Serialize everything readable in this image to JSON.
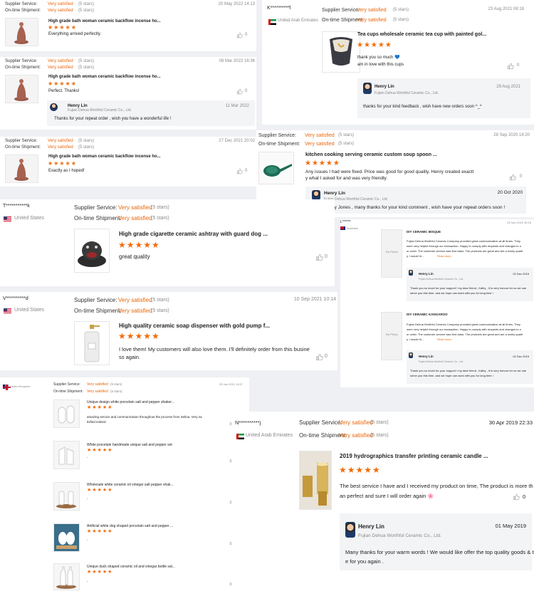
{
  "common": {
    "supplier_service": "Supplier Service:",
    "ontime_shipment": "On-time Shipment:",
    "very_satisfied": "Very satisfied",
    "five_stars": "(5 stars)",
    "stars": "★★★★★",
    "like_count": "0",
    "replier_name": "Henry Lin",
    "replier_company": "Fujian Dehua Worthful Ceramic Co., Ltd.",
    "no_photo": "No Photo"
  },
  "r1": {
    "date": "20 May 2022 14:13",
    "product": "High grade bath woman ceramic backflow incense ho...",
    "comment": "Everything arrived perfectly."
  },
  "r2": {
    "date": "08 Mar 2022 16:36",
    "product": "High grade bath woman ceramic backflow incense ho...",
    "comment": "Perfect. Thanks!",
    "reply_date": "11 Mar 2022",
    "reply_text": "Thanks for your repeat order , wish you have a wonderful life !"
  },
  "r3": {
    "date": "27 Dec 2021 20:02",
    "product": "High grade bath woman ceramic backflow incense ho...",
    "comment": "Exactly as I hoped!"
  },
  "r4": {
    "user": "K**********l",
    "country": "United Arab Emirates",
    "date": "23 Aug 2021 08:18",
    "product": "Tea cups wholesale ceramic tea cup with painted gol...",
    "comment_1": "thank you so much 💙",
    "comment_2": "am in love with this cups",
    "reply_date": "29 Aug 2021",
    "reply_text": "thanks for your kind feedback , wish have new orders soon ^_^"
  },
  "r5": {
    "date": "28 Sep 2020 14:20",
    "product": "kitchen cooking serving ceramic custom soup spoon ...",
    "comment_1": "Any issues I had were fixed. Price was good for good quality. Henry created exactl",
    "comment_2": "y what I asked for and was very friendly.",
    "reply_date": "20 Oct 2020",
    "reply_text": "Dear Tiffany Jones , many thanks for your kind comment , wish have your repeat orders soon !"
  },
  "r6": {
    "user": "T***********k",
    "country": "United States",
    "product": "High grade cigarette ceramic ashtray with guard dog ...",
    "comment": "great quality"
  },
  "r7": {
    "user": "L******",
    "country": "Australia",
    "date": "04 Nov 2015 15:18",
    "items": [
      {
        "title": "DIY CERAMIC BISQUE",
        "text": [
          "Fujian Dehua Worthful Ceramic Company provided great communication at all times. They",
          "were very helpful through our transaction. Happy to comply with requests and changes to o",
          "ur order. The customer service was first class. The products are great and are a lovely qualit",
          "y. I would hi..."
        ],
        "read_more": "Read more",
        "reply_date": "02 Dec 2015",
        "reply_text": [
          "Thank you so much for your support ! my dear friend , Kathy , It is very honour for us we can",
          "serve you this time, and we hope can work with you for long time !"
        ]
      },
      {
        "title": "DIY CERAMIC KANGAROO",
        "text": [
          "Fujian Dehua Worthful Ceramic Company provided great communication at all times. They",
          "were very helpful through our transaction. Happy to comply with requests and changes to o",
          "ur order. The customer service was first class. The products are great and are a lovely qualit",
          "y. I would hi..."
        ],
        "read_more": "Read more",
        "reply_date": "02 Dec 2015",
        "reply_text": [
          "Thank you so much for your support ! my dear friend , Kathy , It is very honour for us we can",
          "serve you this time, and we hope can work with you for long time !"
        ]
      }
    ]
  },
  "r8": {
    "user": "V**********d",
    "country": "United States",
    "date": "10 Sep 2021 10:14",
    "product": "High quality ceramic soap dispenser with gold pump f...",
    "comment_1": "I love them! My customers will also love them. I'll definitely order from this busine",
    "comment_2": "ss again."
  },
  "r9": {
    "country": "United Kingdom",
    "date": "25 Jan 2021 11:57",
    "items": [
      {
        "title": "Unique design white porcelain salt and pepper shaker...",
        "text": [
          "amazing service and communication throughout the process from Selina. Very sa",
          "tisfied indeed."
        ]
      },
      {
        "title": "White porcelain handmade unique salt and pepper set",
        "text": [
          "-"
        ]
      },
      {
        "title": "Wholesale white ceramic oil vinegar salt pepper shak...",
        "text": [
          "-"
        ]
      },
      {
        "title": "Artificial white dog shaped porcelain salt and pepper ...",
        "text": [
          "-"
        ]
      },
      {
        "title": "Unique duck shaped ceramic oil and vinegar bottle sal...",
        "text": [
          "-"
        ]
      }
    ]
  },
  "r10": {
    "user": "N**********j",
    "country": "United Arab Emirates",
    "date": "30 Apr 2019 22:33",
    "product": "2019 hydrographics transfer printing ceramic candle ...",
    "comment_1": "The best service I have and I received my product on time, The product is more th",
    "comment_2": "an perfect and sure I will order again 🌸",
    "reply_date": "01 May 2019",
    "reply_text_1": "Many thanks for your warm words ! We would like offer the top quality goods & the best servic",
    "reply_text_2": "e for you again ."
  },
  "colors": {
    "accent_orange": "#e8650a",
    "star_orange": "#f26b0a",
    "reply_bg": "#f3f4f6"
  }
}
